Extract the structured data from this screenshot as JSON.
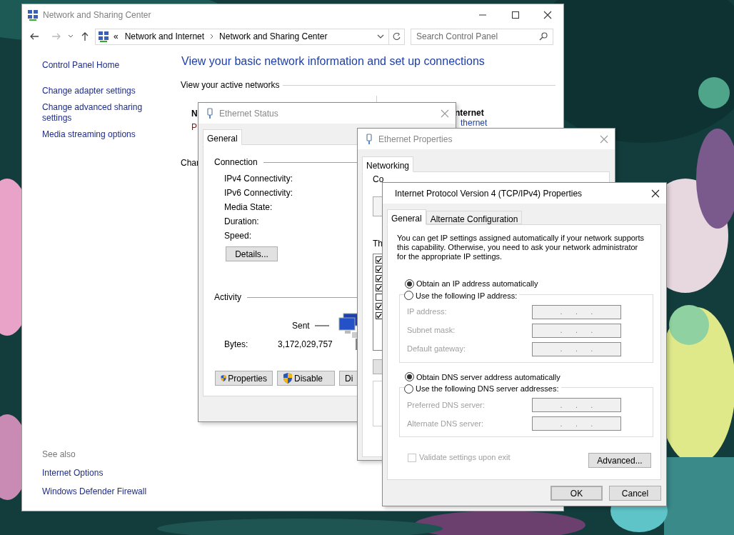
{
  "main_window": {
    "title": "Network and Sharing Center",
    "address": {
      "breadcrumb": [
        "Network and Internet",
        "Network and Sharing Center"
      ],
      "overflow": "«"
    },
    "search": {
      "placeholder": "Search Control Panel"
    },
    "sidebar": {
      "links": [
        "Control Panel Home",
        "Change adapter settings",
        "Change advanced sharing settings",
        "Media streaming options"
      ],
      "see_also_heading": "See also",
      "see_also": [
        "Internet Options",
        "Windows Defender Firewall"
      ]
    },
    "heading": "View your basic network information and set up connections",
    "section_label": "View your active networks",
    "covered_texts": {
      "network_name": "N",
      "network_category": "P",
      "change_heading": "Char",
      "access_type": "nternet",
      "connection_link": "thernet"
    }
  },
  "ethernet_status": {
    "title": "Ethernet Status",
    "tabs": [
      {
        "label": "General",
        "selected": true
      }
    ],
    "connection_heading": "Connection",
    "fields": [
      "IPv4 Connectivity:",
      "IPv6 Connectivity:",
      "Media State:",
      "Duration:",
      "Speed:"
    ],
    "details_button": "Details...",
    "activity_heading": "Activity",
    "sent_label": "Sent",
    "bytes_label": "Bytes:",
    "bytes_sent": "3,172,029,757",
    "buttons": [
      {
        "label": "Properties",
        "shield": true
      },
      {
        "label": "Disable",
        "shield": true
      },
      {
        "label": "Di",
        "shield": false
      }
    ]
  },
  "ethernet_properties": {
    "title": "Ethernet Properties",
    "tabs": [
      {
        "label": "Networking",
        "selected": true
      }
    ],
    "covered_texts": {
      "connect_using": "Co",
      "components_label": "Th"
    },
    "components": [
      {
        "checked": true
      },
      {
        "checked": true
      },
      {
        "checked": true
      },
      {
        "checked": true
      },
      {
        "checked": false
      },
      {
        "checked": true
      },
      {
        "checked": true
      }
    ]
  },
  "ipv4_dialog": {
    "title": "Internet Protocol Version 4 (TCP/IPv4) Properties",
    "tabs": [
      {
        "label": "General",
        "selected": true
      },
      {
        "label": "Alternate Configuration",
        "selected": false
      }
    ],
    "description": "You can get IP settings assigned automatically if your network supports this capability. Otherwise, you need to ask your network administrator for the appropriate IP settings.",
    "ip_options": [
      {
        "label": "Obtain an IP address automatically",
        "selected": true
      },
      {
        "label": "Use the following IP address:",
        "selected": false
      }
    ],
    "ip_fields": [
      {
        "label": "IP address:",
        "value": ".      .      .",
        "disabled": true
      },
      {
        "label": "Subnet mask:",
        "value": ".      .      .",
        "disabled": true
      },
      {
        "label": "Default gateway:",
        "value": ".      .      .",
        "disabled": true
      }
    ],
    "dns_options": [
      {
        "label": "Obtain DNS server address automatically",
        "selected": true
      },
      {
        "label": "Use the following DNS server addresses:",
        "selected": false
      }
    ],
    "dns_fields": [
      {
        "label": "Preferred DNS server:",
        "value": ".      .      .",
        "disabled": true
      },
      {
        "label": "Alternate DNS server:",
        "value": ".      .      .",
        "disabled": true
      }
    ],
    "validate": {
      "label": "Validate settings upon exit",
      "checked": false,
      "disabled": true
    },
    "advanced_button": "Advanced...",
    "buttons": [
      {
        "label": "OK",
        "default": true
      },
      {
        "label": "Cancel",
        "default": false
      }
    ]
  }
}
